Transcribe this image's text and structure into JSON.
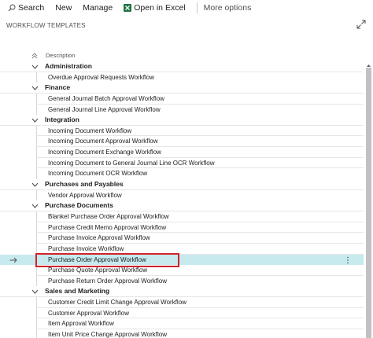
{
  "toolbar": {
    "search_label": "Search",
    "new_label": "New",
    "manage_label": "Manage",
    "open_excel_label": "Open in Excel",
    "more_options_label": "More options",
    "excel_color": "#217346"
  },
  "page": {
    "title": "WORKFLOW TEMPLATES"
  },
  "list": {
    "column_header": "Description",
    "selected_color": "#c6eaee",
    "highlight_color": "#d0232a",
    "groups": [
      {
        "label": "Administration",
        "items": [
          "Overdue Approval Requests Workflow"
        ]
      },
      {
        "label": "Finance",
        "items": [
          "General Journal Batch Approval Workflow",
          "General Journal Line Approval Workflow"
        ]
      },
      {
        "label": "Integration",
        "items": [
          "Incoming Document Workflow",
          "Incoming Document Approval Workflow",
          "Incoming Document Exchange Workflow",
          "Incoming Document to General Journal Line OCR Workflow",
          "Incoming Document OCR Workflow"
        ]
      },
      {
        "label": "Purchases and Payables",
        "items": [
          "Vendor Approval Workflow"
        ]
      },
      {
        "label": "Purchase Documents",
        "items": [
          "Blanket Purchase Order Approval Workflow",
          "Purchase Credit Memo Approval Workflow",
          "Purchase Invoice Approval Workflow",
          "Purchase Invoice Workflow",
          "Purchase Order Approval Workflow",
          "Purchase Quote Approval Workflow",
          "Purchase Return Order Approval Workflow"
        ]
      },
      {
        "label": "Sales and Marketing",
        "items": [
          "Customer Credit Limit Change Approval Workflow",
          "Customer Approval Workflow",
          "Item Approval Workflow",
          "Item Unit Price Change Approval Workflow"
        ]
      }
    ],
    "selected_item": "Purchase Order Approval Workflow"
  }
}
